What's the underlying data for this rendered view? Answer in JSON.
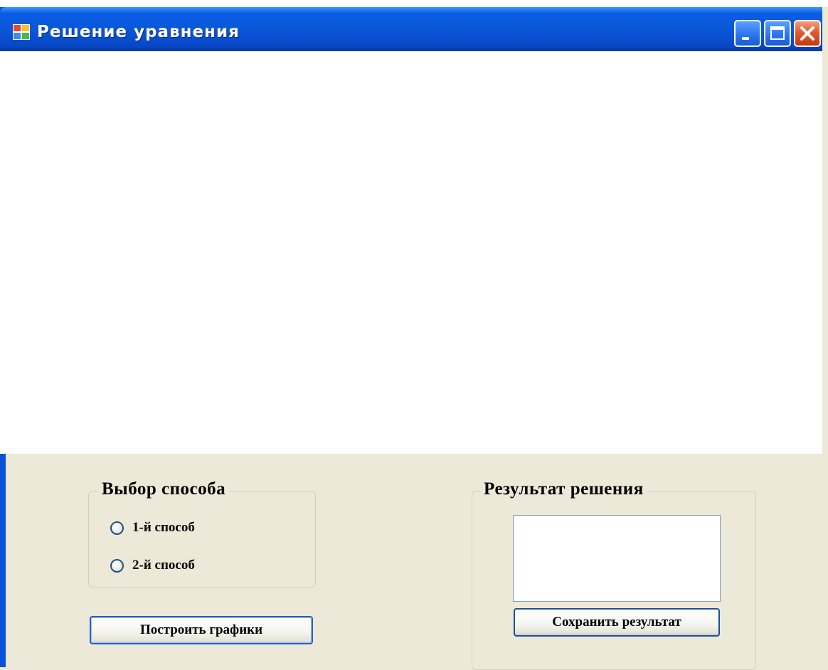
{
  "window": {
    "title": "Решение уравнения",
    "icon": "app-window-icon",
    "controls": [
      "minimize-icon",
      "maximize-icon",
      "close-icon"
    ]
  },
  "method_group": {
    "legend": "Выбор способа",
    "options": [
      {
        "label": "1-й способ",
        "checked": false
      },
      {
        "label": "2-й способ",
        "checked": false
      }
    ]
  },
  "result_group": {
    "legend": "Результат решения",
    "result_value": "",
    "save_label": "Сохранить результат"
  },
  "plot_button": {
    "label": "Построить графики"
  },
  "colors": {
    "titlebar": "#0a57d8",
    "form_background": "#ece9d8",
    "plot_area": "#ffffff",
    "close_button": "#e05a30"
  }
}
